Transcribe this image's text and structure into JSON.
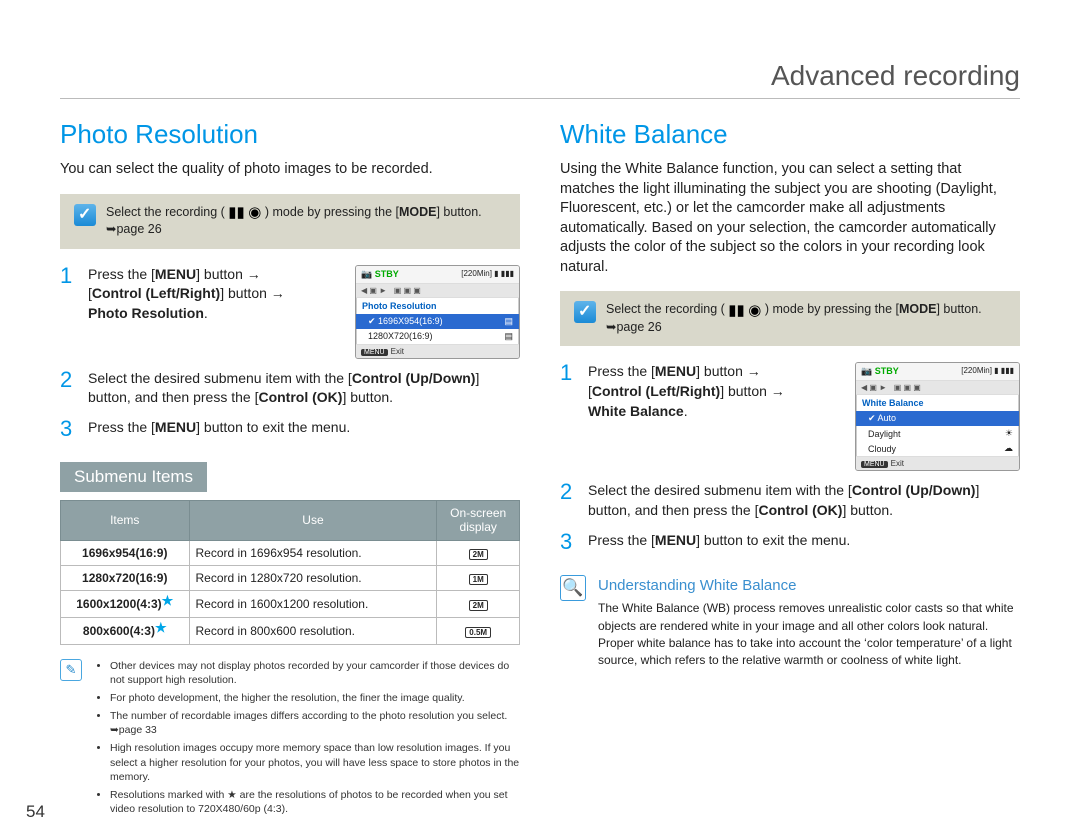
{
  "chapter_title": "Advanced recording",
  "page_number": "54",
  "left": {
    "section_title": "Photo Resolution",
    "intro": "You can select the quality of photo images to be recorded.",
    "callout_prefix": "Select the recording ( ",
    "callout_mid": " ) mode by pressing the [",
    "callout_mode": "MODE",
    "callout_suffix": "] button. ➥page 26",
    "steps": {
      "s1a": "Press the [",
      "s1_menu": "MENU",
      "s1b": "] button ",
      "s1c": "[",
      "s1_ctrl": "Control (Left/Right)",
      "s1d": "] button ",
      "s1e": "Photo Resolution",
      "s1f": ".",
      "s2a": "Select the desired submenu item with the [",
      "s2_updown": "Control (Up/Down)",
      "s2b": "] button, and then press the [",
      "s2_ok": "Control (OK)",
      "s2c": "] button.",
      "s3a": "Press the [",
      "s3_menu": "MENU",
      "s3b": "] button to exit the menu."
    },
    "lcd": {
      "stby": "STBY",
      "time_badge": "[220Min]",
      "title": "Photo Resolution",
      "row1": "1696X954(16:9)",
      "row2": "1280X720(16:9)",
      "exit": "Exit"
    },
    "submenu_title": "Submenu Items",
    "table": {
      "th1": "Items",
      "th2": "Use",
      "th3": "On-screen display",
      "rows": [
        {
          "item": "1696x954(16:9)",
          "star": false,
          "use": "Record in 1696x954 resolution.",
          "disp": "2M"
        },
        {
          "item": "1280x720(16:9)",
          "star": false,
          "use": "Record in 1280x720 resolution.",
          "disp": "1M"
        },
        {
          "item": "1600x1200(4:3)",
          "star": true,
          "use": "Record in 1600x1200 resolution.",
          "disp": "2M"
        },
        {
          "item": "800x600(4:3)",
          "star": true,
          "use": "Record in 800x600 resolution.",
          "disp": "0.5M"
        }
      ]
    },
    "notes": [
      "Other devices may not display photos recorded by your camcorder if those devices do not support high resolution.",
      "For photo development, the higher the resolution, the finer the image quality.",
      "The number of recordable images differs according to the photo resolution you select. ➥page 33",
      "High resolution images occupy more memory space than low resolution images. If you select a higher resolution for your photos, you will have less space to store photos in the memory.",
      "Resolutions marked with ★ are the resolutions of photos to be recorded when you set video resolution to 720X480/60p (4:3)."
    ]
  },
  "right": {
    "section_title": "White Balance",
    "intro": "Using the White Balance function, you can select a setting that matches the light illuminating the subject you are shooting (Daylight, Fluorescent, etc.) or let the camcorder make all adjustments automatically. Based on your selection, the camcorder automatically adjusts the color of the subject so the colors in your recording look natural.",
    "callout_prefix": "Select the recording ( ",
    "callout_mid": " ) mode by pressing the [",
    "callout_mode": "MODE",
    "callout_suffix": "] button. ➥page 26",
    "steps": {
      "s1a": "Press the [",
      "s1_menu": "MENU",
      "s1b": "] button ",
      "s1c": "[",
      "s1_ctrl": "Control (Left/Right)",
      "s1d": "] button ",
      "s1e": "White Balance",
      "s1f": ".",
      "s2a": "Select the desired submenu item with the [",
      "s2_updown": "Control (Up/Down)",
      "s2b": "] button, and then press the [",
      "s2_ok": "Control (OK)",
      "s2c": "] button.",
      "s3a": "Press the [",
      "s3_menu": "MENU",
      "s3b": "] button to exit the menu."
    },
    "lcd": {
      "stby": "STBY",
      "time_badge": "[220Min]",
      "title": "White Balance",
      "row1": "Auto",
      "row2": "Daylight",
      "row3": "Cloudy",
      "exit": "Exit"
    },
    "understanding": {
      "title": "Understanding White Balance",
      "body": "The White Balance (WB) process removes unrealistic color casts so that white objects are rendered white in your image and all other colors look natural. Proper white balance has to take into account the ‘color temperature’ of a light source, which refers to the relative warmth or coolness of white light."
    }
  }
}
